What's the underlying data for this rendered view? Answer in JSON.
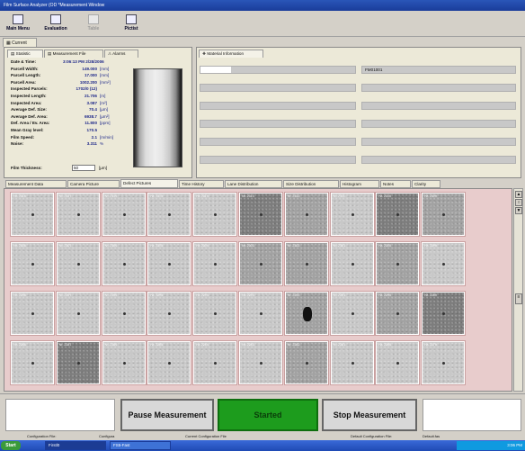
{
  "window": {
    "title": "Film Surface Analyzer (OD *Measurement Window"
  },
  "toolbar": {
    "buttons": [
      {
        "label": "Main Menu",
        "icon": "menu-icon",
        "enabled": true
      },
      {
        "label": "Evaluation",
        "icon": "evaluation-icon",
        "enabled": true
      },
      {
        "label": "Table",
        "icon": "table-icon",
        "enabled": false
      },
      {
        "label": "Pictist",
        "icon": "picture-list-icon",
        "enabled": true
      }
    ]
  },
  "main_tab": "Current",
  "sub_tabs": [
    "Statistic",
    "Measurement File",
    "Alarms"
  ],
  "material_tab": "Material Information",
  "statistics": [
    {
      "label": "Date & Time:",
      "value": "3:06:13 PM  2/28/2006",
      "unit": ""
    },
    {
      "label": "Parcell Width:",
      "value": "149.000",
      "unit": "[mm]"
    },
    {
      "label": "Parcell Length:",
      "value": "17.000",
      "unit": "[mm]"
    },
    {
      "label": "Parcell Area:",
      "value": "1002.200",
      "unit": "[mm²]"
    },
    {
      "label": "Inspected Parcels:",
      "value": "1702/0 (12)",
      "unit": ""
    },
    {
      "label": "Inspected Length:",
      "value": "21.706",
      "unit": "[m]"
    },
    {
      "label": "Inspected Area:",
      "value": "3.087",
      "unit": "[m²]"
    },
    {
      "label": "Average Def. Size:",
      "value": "70.4",
      "unit": "[µm]"
    },
    {
      "label": "Average Def. Area:",
      "value": "6938.7",
      "unit": "[µm²]"
    },
    {
      "label": "Def. Area / Ev. Area:",
      "value": "11.800",
      "unit": "[ppm]"
    },
    {
      "label": "Mean Gray level:",
      "value": "170.5",
      "unit": ""
    },
    {
      "label": "Film Speed:",
      "value": "2.1",
      "unit": "[m/min]"
    },
    {
      "label": "Noise:",
      "value": "3.311",
      "unit": "%"
    }
  ],
  "film_thickness": {
    "label": "Film Thickness:",
    "value": "50",
    "unit": "[µm]"
  },
  "material_info": {
    "fields": [
      "",
      "FM01001",
      "",
      "",
      "",
      "",
      "",
      "",
      "",
      "",
      "",
      ""
    ]
  },
  "view_tabs": [
    "Measurement Data",
    "Camera Picture",
    "Defect Pictures",
    "Time History",
    "Lane Distribution",
    "Size Distribution",
    "Histogram",
    "Notes",
    "Clarity"
  ],
  "active_view_tab": "Defect Pictures",
  "defects": [
    {
      "tone": "light",
      "cap": "Nr. 2318"
    },
    {
      "tone": "light",
      "cap": "Nr. 2317"
    },
    {
      "tone": "light",
      "cap": "Nr. 2316"
    },
    {
      "tone": "light",
      "cap": "Nr. 2315"
    },
    {
      "tone": "light",
      "cap": "Nr. 2314"
    },
    {
      "tone": "dark",
      "cap": "Nr. 2313"
    },
    {
      "tone": "mid",
      "cap": "Nr. 2312"
    },
    {
      "tone": "light",
      "cap": "Nr. 2311"
    },
    {
      "tone": "dark",
      "cap": "Nr. 2310"
    },
    {
      "tone": "mid",
      "cap": "Nr. 2309"
    },
    {
      "tone": "light",
      "cap": "Nr. 2308"
    },
    {
      "tone": "light",
      "cap": "Nr. 2307"
    },
    {
      "tone": "light",
      "cap": "Nr. 2306"
    },
    {
      "tone": "light",
      "cap": "Nr. 2305"
    },
    {
      "tone": "light",
      "cap": "Nr. 2304"
    },
    {
      "tone": "mid",
      "cap": "Nr. 2303"
    },
    {
      "tone": "mid",
      "cap": "Nr. 2302"
    },
    {
      "tone": "light",
      "cap": "Nr. 2301"
    },
    {
      "tone": "mid",
      "cap": "Nr. 2300"
    },
    {
      "tone": "light",
      "cap": "Nr. 2299"
    },
    {
      "tone": "light",
      "cap": "Nr. 2298"
    },
    {
      "tone": "light",
      "cap": "Nr. 2297"
    },
    {
      "tone": "light",
      "cap": "Nr. 2296"
    },
    {
      "tone": "light",
      "cap": "Nr. 2295"
    },
    {
      "tone": "light",
      "cap": "Nr. 2294"
    },
    {
      "tone": "light",
      "cap": "Nr. 2293"
    },
    {
      "tone": "mid",
      "cap": "Nr. 2292"
    },
    {
      "tone": "light",
      "cap": "Nr. 2291"
    },
    {
      "tone": "mid",
      "cap": "Nr. 2290"
    },
    {
      "tone": "dark",
      "cap": "Nr. 2289"
    },
    {
      "tone": "light",
      "cap": "Nr. 2288"
    },
    {
      "tone": "dark",
      "cap": "Nr. 2287"
    },
    {
      "tone": "light",
      "cap": "Nr. 2286"
    },
    {
      "tone": "light",
      "cap": "Nr. 2285"
    },
    {
      "tone": "light",
      "cap": "Nr. 2284"
    },
    {
      "tone": "light",
      "cap": "Nr. 2283"
    },
    {
      "tone": "mid",
      "cap": "Nr. 2282"
    },
    {
      "tone": "light",
      "cap": "Nr. 2281"
    },
    {
      "tone": "light",
      "cap": "Nr. 2280"
    },
    {
      "tone": "light",
      "cap": "Nr. 2279"
    }
  ],
  "controls": {
    "pause_label": "Pause Measurement",
    "started_label": "Started",
    "stop_label": "Stop Measurement"
  },
  "status_bar": {
    "configuration_file": "Configuration File:",
    "config_name": "Configura",
    "current_config": "Current Configuration File",
    "default_config": "Default Configuration File:",
    "default_value": "Default.fas"
  },
  "taskbar": {
    "start_label": "Start",
    "tasks": [
      "Firstl0",
      "FS5-Fast"
    ],
    "clock": "3:06 PM"
  },
  "colors": {
    "started": "#1d9c1d",
    "title_bar": "#1a3c9a",
    "thumb_border": "#c9a0a0"
  }
}
